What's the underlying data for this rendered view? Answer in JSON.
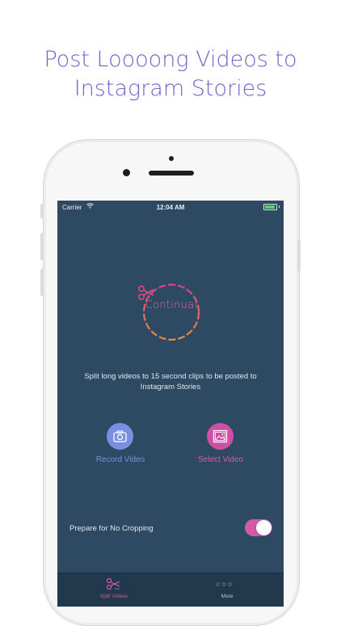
{
  "headline": {
    "line1": "Post Loooong Videos to",
    "line2": "Instagram Stories"
  },
  "status_bar": {
    "carrier": "Carrier",
    "time": "12:04 AM",
    "battery_color": "#4cd964"
  },
  "app": {
    "logo_text": "Continual",
    "description": "Split long videos to 15 second clips to be posted to Instagram Stories",
    "record": {
      "label": "Record Video",
      "icon": "camera-icon",
      "color": "#7b8fe0"
    },
    "select": {
      "label": "Select Video",
      "icon": "image-icon",
      "color": "#cf4ea7"
    },
    "option": {
      "label": "Prepare for No Cropping",
      "enabled": true
    }
  },
  "tabbar": {
    "tabs": [
      {
        "label": "Split Videos",
        "icon": "scissors-icon",
        "active": true
      },
      {
        "label": "More",
        "icon": "more-dots-icon",
        "active": false
      }
    ]
  },
  "colors": {
    "screen_bg": "#2e4a62",
    "accent_pink": "#d25aa8",
    "accent_blue": "#7b8fe0",
    "headline": "#6f63cf"
  }
}
